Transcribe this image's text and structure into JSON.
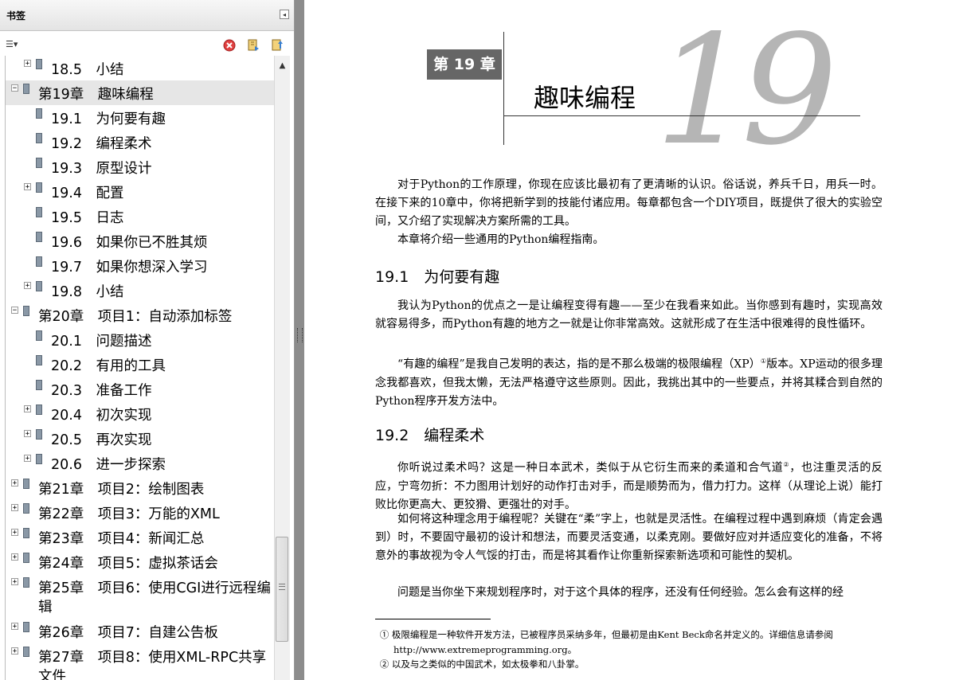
{
  "sidebar": {
    "title": "书签",
    "collapse_glyph": "◂",
    "options_glyph": "☰▾",
    "scroll_up_glyph": "▲",
    "items": [
      {
        "text": "18.5　小结",
        "level": 2,
        "toggle": "+"
      },
      {
        "text": "第19章　趣味编程",
        "level": 1,
        "toggle": "−",
        "selected": true
      },
      {
        "text": "19.1　为何要有趣",
        "level": 2,
        "toggle": ""
      },
      {
        "text": "19.2　编程柔术",
        "level": 2,
        "toggle": ""
      },
      {
        "text": "19.3　原型设计",
        "level": 2,
        "toggle": ""
      },
      {
        "text": "19.4　配置",
        "level": 2,
        "toggle": "+"
      },
      {
        "text": "19.5　日志",
        "level": 2,
        "toggle": ""
      },
      {
        "text": "19.6　如果你已不胜其烦",
        "level": 2,
        "toggle": ""
      },
      {
        "text": "19.7　如果你想深入学习",
        "level": 2,
        "toggle": ""
      },
      {
        "text": "19.8　小结",
        "level": 2,
        "toggle": "+"
      },
      {
        "text": "第20章　项目1：自动添加标签",
        "level": 1,
        "toggle": "−"
      },
      {
        "text": "20.1　问题描述",
        "level": 2,
        "toggle": ""
      },
      {
        "text": "20.2　有用的工具",
        "level": 2,
        "toggle": ""
      },
      {
        "text": "20.3　准备工作",
        "level": 2,
        "toggle": ""
      },
      {
        "text": "20.4　初次实现",
        "level": 2,
        "toggle": "+"
      },
      {
        "text": "20.5　再次实现",
        "level": 2,
        "toggle": "+"
      },
      {
        "text": "20.6　进一步探索",
        "level": 2,
        "toggle": "+"
      },
      {
        "text": "第21章　项目2：绘制图表",
        "level": 1,
        "toggle": "+"
      },
      {
        "text": "第22章　项目3：万能的XML",
        "level": 1,
        "toggle": "+"
      },
      {
        "text": "第23章　项目4：新闻汇总",
        "level": 1,
        "toggle": "+"
      },
      {
        "text": "第24章　项目5：虚拟茶话会",
        "level": 1,
        "toggle": "+"
      },
      {
        "text": "第25章　项目6：使用CGI进行远程编",
        "text2": "辑",
        "level": 1,
        "toggle": "+"
      },
      {
        "text": "第26章　项目7：自建公告板",
        "level": 1,
        "toggle": "+"
      },
      {
        "text": "第27章　项目8：使用XML-RPC共享",
        "text2": "文件",
        "level": 1,
        "toggle": "+"
      }
    ]
  },
  "document": {
    "chapter_label": "第 19 章",
    "chapter_title": "趣味编程",
    "chapter_number": "19",
    "intro_1": "对于Python的工作原理，你现在应该比最初有了更清晰的认识。俗话说，养兵千日，用兵一时。在接下来的10章中，你将把新学到的技能付诸应用。每章都包含一个DIY项目，既提供了很大的实验空间，又介绍了实现解决方案所需的工具。",
    "intro_2": "本章将介绍一些通用的Python编程指南。",
    "section_1": "19.1　为何要有趣",
    "s1_p1": "我认为Python的优点之一是让编程变得有趣——至少在我看来如此。当你感到有趣时，实现高效就容易得多，而Python有趣的地方之一就是让你非常高效。这就形成了在生活中很难得的良性循环。",
    "s1_p2_a": "“有趣的编程”是我自己发明的表达，指的是不那么极端的极限编程（XP）",
    "s1_p2_sup": "①",
    "s1_p2_b": "版本。XP运动的很多理念我都喜欢，但我太懒，无法严格遵守这些原则。因此，我挑出其中的一些要点，并将其糅合到自然的Python程序开发方法中。",
    "section_2": "19.2　编程柔术",
    "s2_p1_a": "你听说过柔术吗？这是一种日本武术，类似于从它衍生而来的柔道和合气道",
    "s2_p1_sup": "②",
    "s2_p1_b": "，也注重灵活的反应，宁弯勿折：不力图用计划好的动作打击对手，而是顺势而为，借力打力。这样（从理论上说）能打败比你更高大、更狡猾、更强壮的对手。",
    "s2_p2": "如何将这种理念用于编程呢？关键在“柔”字上，也就是灵活性。在编程过程中遇到麻烦（肯定会遇到）时，不要固守最初的设计和想法，而要灵活变通，以柔克刚。要做好应对并适应变化的准备，不将意外的事故视为令人气馁的打击，而是将其看作让你重新探索新选项和可能性的契机。",
    "s2_p3": "问题是当你坐下来规划程序时，对于这个具体的程序，还没有任何经验。怎么会有这样的经",
    "footnote_1": "① 极限编程是一种软件开发方法，已被程序员采纳多年，但最初是由Kent Beck命名并定义的。详细信息请参阅http://www.extremeprogramming.org。",
    "footnote_2": "② 以及与之类似的中国武术，如太极拳和八卦掌。"
  },
  "colors": {
    "chapter_tag_bg": "#666666",
    "chapter_number": "#b5b5b5",
    "splitter": "#8c8c8c"
  }
}
